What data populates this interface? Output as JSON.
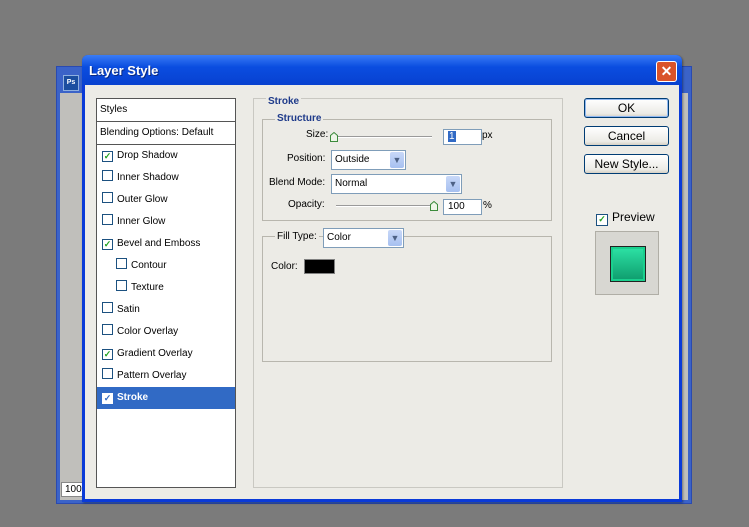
{
  "background_window": {
    "zoom": "100%",
    "app_icon": "ps-icon"
  },
  "dialog": {
    "title": "Layer Style",
    "close_glyph": "✕"
  },
  "styles": {
    "header": "Styles",
    "blending_options": "Blending Options: Default",
    "items": [
      {
        "label": "Drop Shadow",
        "checked": true
      },
      {
        "label": "Inner Shadow",
        "checked": false
      },
      {
        "label": "Outer Glow",
        "checked": false
      },
      {
        "label": "Inner Glow",
        "checked": false
      },
      {
        "label": "Bevel and Emboss",
        "checked": true
      },
      {
        "label": "Contour",
        "checked": false
      },
      {
        "label": "Texture",
        "checked": false
      },
      {
        "label": "Satin",
        "checked": false
      },
      {
        "label": "Color Overlay",
        "checked": false
      },
      {
        "label": "Gradient Overlay",
        "checked": true
      },
      {
        "label": "Pattern Overlay",
        "checked": false
      },
      {
        "label": "Stroke",
        "checked": true,
        "selected": true
      }
    ]
  },
  "stroke": {
    "section_title": "Stroke",
    "structure_title": "Structure",
    "size_label": "Size:",
    "size_value": "1",
    "size_unit": "px",
    "size_slider": 0.0,
    "position_label": "Position:",
    "position_value": "Outside",
    "blend_mode_label": "Blend Mode:",
    "blend_mode_value": "Normal",
    "opacity_label": "Opacity:",
    "opacity_value": "100",
    "opacity_unit": "%",
    "opacity_slider": 1.0,
    "fill_type_label": "Fill Type:",
    "fill_type_value": "Color",
    "color_label": "Color:",
    "color_value": "#000000"
  },
  "buttons": {
    "ok": "OK",
    "cancel": "Cancel",
    "new_style": "New Style..."
  },
  "preview": {
    "label": "Preview",
    "checked": true,
    "swatch_color": "#17c98c"
  }
}
